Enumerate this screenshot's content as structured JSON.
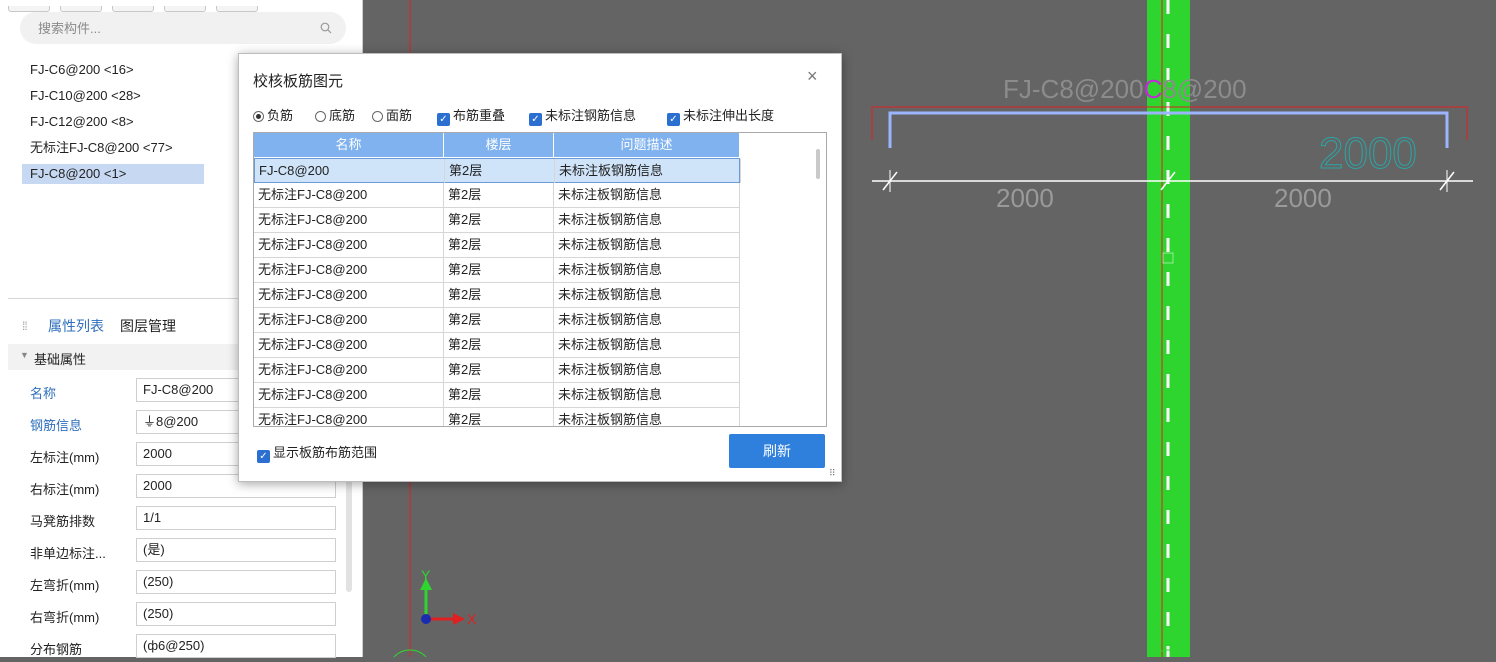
{
  "search": {
    "placeholder": "搜索构件..."
  },
  "components": [
    {
      "label": "FJ-C6@200 <16>",
      "selected": false
    },
    {
      "label": "FJ-C10@200 <28>",
      "selected": false
    },
    {
      "label": "FJ-C12@200 <8>",
      "selected": false
    },
    {
      "label": "无标注FJ-C8@200 <77>",
      "selected": false
    },
    {
      "label": "FJ-C8@200 <1>",
      "selected": true
    }
  ],
  "tabs": {
    "props": "属性列表",
    "layers": "图层管理"
  },
  "section": {
    "title": "基础属性"
  },
  "properties": [
    {
      "label": "名称",
      "value": "FJ-C8@200",
      "blue": true
    },
    {
      "label": "钢筋信息",
      "value": "⏚8@200",
      "blue": true
    },
    {
      "label": "左标注(mm)",
      "value": "2000",
      "blue": false
    },
    {
      "label": "右标注(mm)",
      "value": "2000",
      "blue": false
    },
    {
      "label": "马凳筋排数",
      "value": "1/1",
      "blue": false
    },
    {
      "label": "非单边标注...",
      "value": "(是)",
      "blue": false
    },
    {
      "label": "左弯折(mm)",
      "value": "(250)",
      "blue": false
    },
    {
      "label": "右弯折(mm)",
      "value": "(250)",
      "blue": false
    },
    {
      "label": "分布钢筋",
      "value": "(ф6@250)",
      "blue": false
    }
  ],
  "dialog": {
    "title": "校核板筋图元",
    "close": "×",
    "options": {
      "r1": "负筋",
      "r2": "底筋",
      "r3": "面筋",
      "c1": "布筋重叠",
      "c2": "未标注钢筋信息",
      "c3": "未标注伸出长度"
    },
    "columns": [
      "名称",
      "楼层",
      "问题描述"
    ],
    "rows": [
      [
        "FJ-C8@200",
        "第2层",
        "未标注板钢筋信息"
      ],
      [
        "无标注FJ-C8@200",
        "第2层",
        "未标注板钢筋信息"
      ],
      [
        "无标注FJ-C8@200",
        "第2层",
        "未标注板钢筋信息"
      ],
      [
        "无标注FJ-C8@200",
        "第2层",
        "未标注板钢筋信息"
      ],
      [
        "无标注FJ-C8@200",
        "第2层",
        "未标注板钢筋信息"
      ],
      [
        "无标注FJ-C8@200",
        "第2层",
        "未标注板钢筋信息"
      ],
      [
        "无标注FJ-C8@200",
        "第2层",
        "未标注板钢筋信息"
      ],
      [
        "无标注FJ-C8@200",
        "第2层",
        "未标注板钢筋信息"
      ],
      [
        "无标注FJ-C8@200",
        "第2层",
        "未标注板钢筋信息"
      ],
      [
        "无标注FJ-C8@200",
        "第2层",
        "未标注板钢筋信息"
      ],
      [
        "无标注FJ-C8@200",
        "第2层",
        "未标注板钢筋信息"
      ]
    ],
    "show_range": "显示板筋布筋范围",
    "refresh": "刷新"
  },
  "canvas": {
    "label_main": "FJ-C8@200",
    "label_c": "C",
    "label_tail": "8@200",
    "dim_left": "2000",
    "dim_right": "2000",
    "dim_overlay": "2000",
    "axis_x": "X",
    "axis_y": "Y"
  },
  "colors": {
    "canvas_bg": "#646464",
    "beam_green": "#2fd52f",
    "red_line": "#e02020",
    "rebar_blue": "#9bb6ff",
    "accent": "#2f7fdd"
  }
}
